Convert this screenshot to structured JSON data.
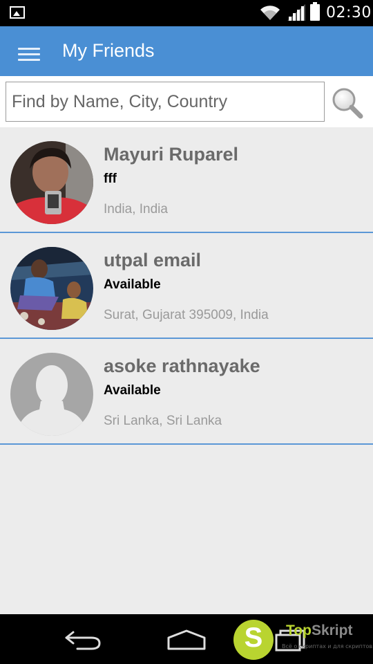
{
  "status_bar": {
    "time": "02:30",
    "icons": [
      "image-icon",
      "wifi-icon",
      "signal-icon",
      "battery-icon"
    ]
  },
  "app_bar": {
    "title": "My Friends",
    "menu_icon": "menu-icon",
    "color": "#4a8fd4"
  },
  "search": {
    "placeholder": "Find by Name, City, Country",
    "value": "",
    "icon": "search-icon"
  },
  "friends": [
    {
      "name": "Mayuri Ruparel",
      "status": "fff",
      "location": "India, India",
      "avatar": "photo"
    },
    {
      "name": "utpal email",
      "status": "Available",
      "location": "Surat, Gujarat 395009, India",
      "avatar": "photo"
    },
    {
      "name": "asoke rathnayake",
      "status": "Available",
      "location": "Sri Lanka, Sri Lanka",
      "avatar": "placeholder"
    }
  ],
  "nav_bar": {
    "icons": [
      "back-icon",
      "home-icon",
      "recent-apps-icon"
    ]
  },
  "watermark": {
    "letter": "S",
    "brand_top": "Top",
    "brand_bottom": "Skript",
    "tagline": "Всё о скриптах и для скриптов..."
  },
  "colors": {
    "accent": "#4a8fd4",
    "divider": "#5b97d6",
    "background": "#ececec",
    "name_text": "#6a6a6a",
    "location_text": "#9a9a9a"
  }
}
